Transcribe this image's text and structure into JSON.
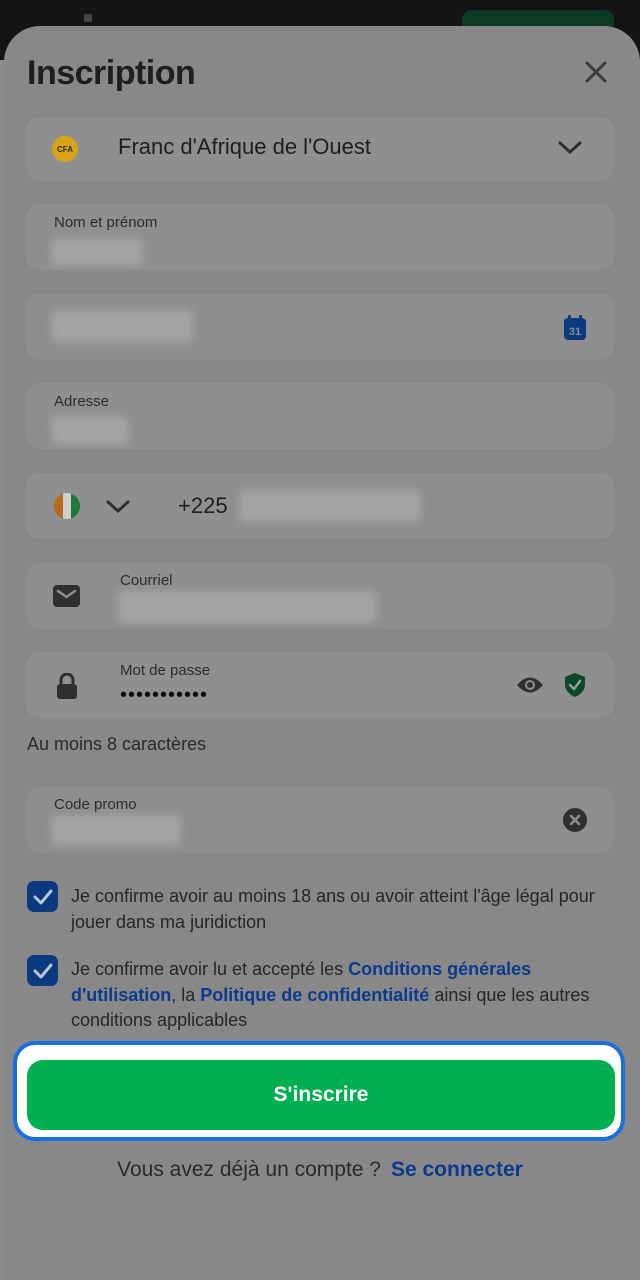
{
  "header": {
    "title": "Inscription",
    "close_icon": "close-icon"
  },
  "currency": {
    "badge": "CFA",
    "value": "Franc d'Afrique de l'Ouest",
    "icon": "chevron-down-icon"
  },
  "fields": {
    "name_label": "Nom et prénom",
    "birthdate_icon": "calendar-icon",
    "calendar_day": "31",
    "address_label": "Adresse",
    "phone_code": "+225",
    "phone_flag": "flag-icon",
    "email_label": "Courriel",
    "password_label": "Mot de passe",
    "password_value": "•••••••••••",
    "password_hint": "Au moins 8 caractères",
    "promo_label": "Code promo"
  },
  "checkboxes": {
    "age": "Je confirme avoir au moins 18 ans ou avoir atteint l'âge légal pour jouer dans ma juridiction",
    "terms_prefix": "Je confirme avoir lu et accepté les ",
    "terms_link": "Conditions générales d'utilisation",
    "terms_middle": ", la ",
    "privacy_link": "Politique de confidentialité",
    "terms_suffix": " ainsi que les autres conditions applicables"
  },
  "submit": {
    "label": "S'inscrire"
  },
  "footer": {
    "question": "Vous avez déjà un compte ?",
    "login_link": "Se connecter"
  },
  "colors": {
    "accent_green": "#00b050",
    "link_blue": "#0c3a8e",
    "focus_outline": "#1a6fe0"
  }
}
